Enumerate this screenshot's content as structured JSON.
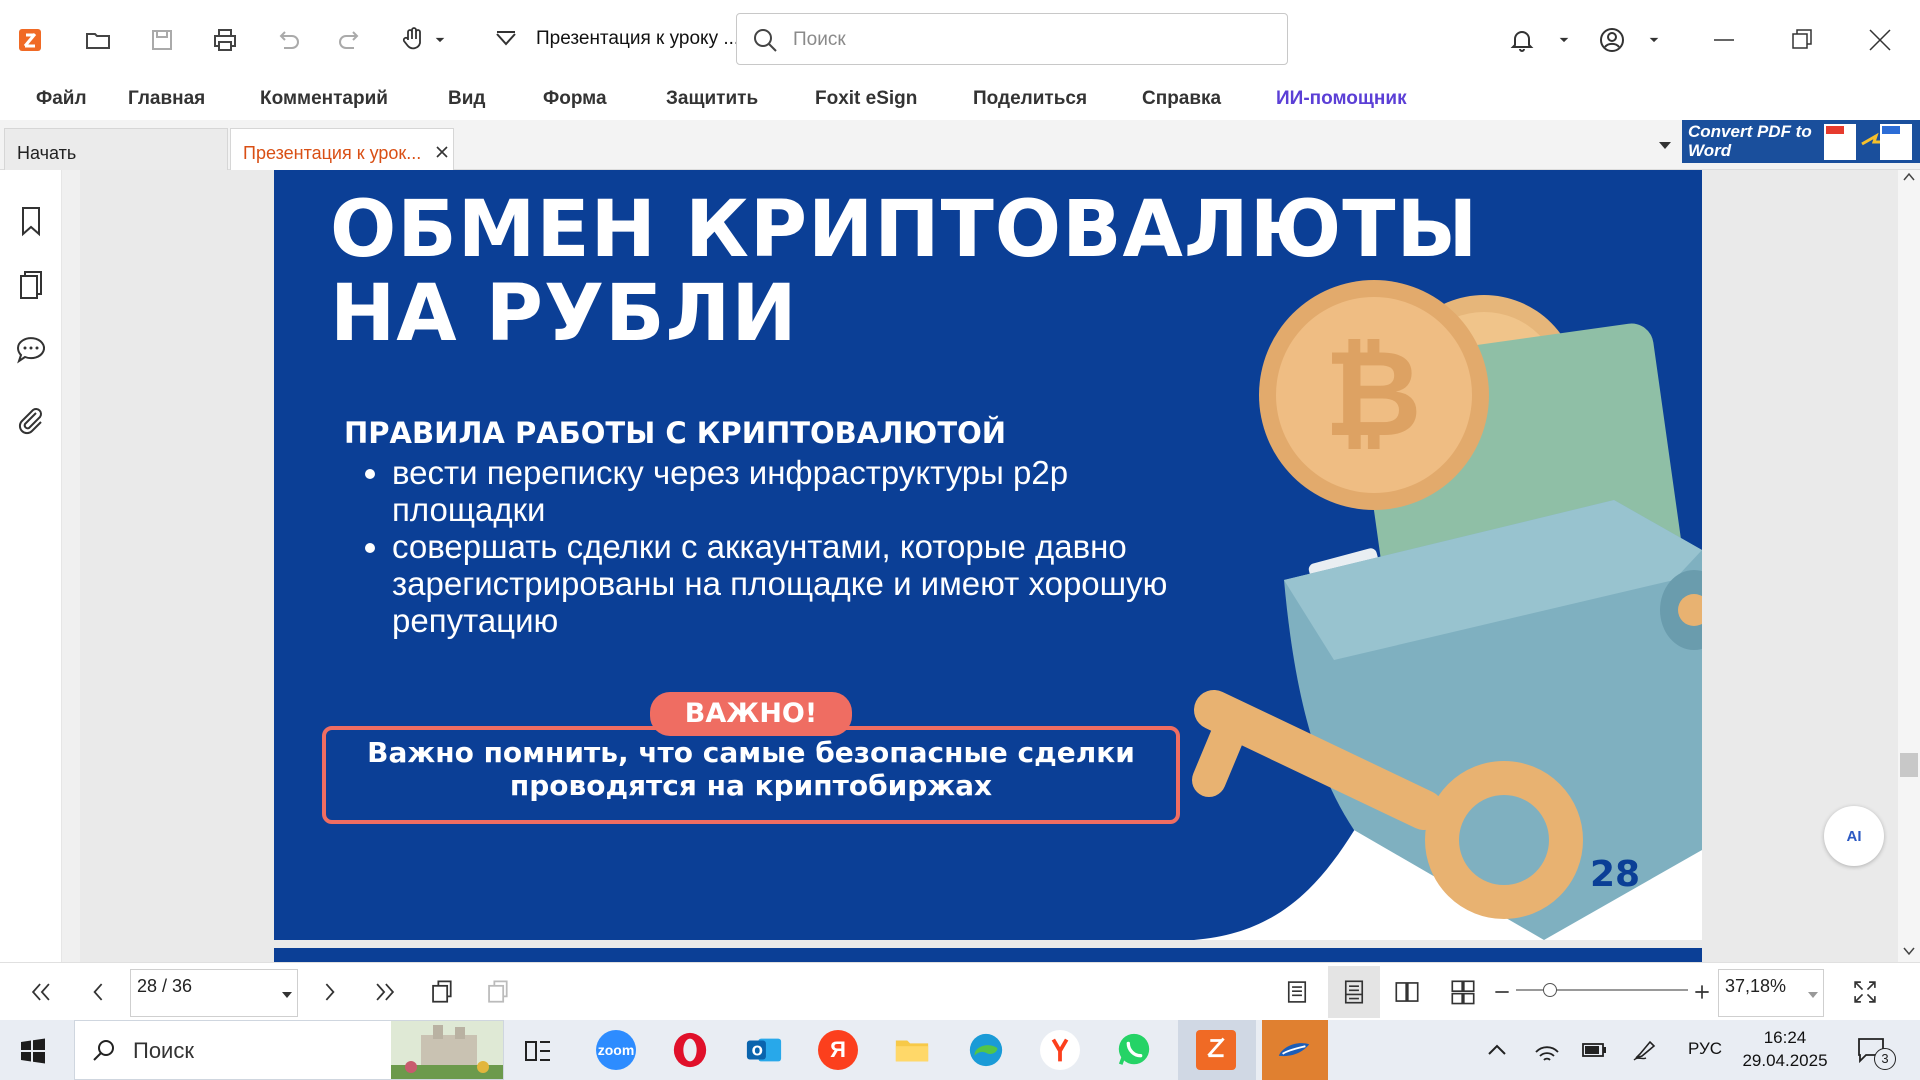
{
  "app": {
    "document_title": "Презентация к уроку ...",
    "search_placeholder": "Поиск"
  },
  "menu": [
    "Файл",
    "Главная",
    "Комментарий",
    "Вид",
    "Форма",
    "Защитить",
    "Foxit eSign",
    "Поделиться",
    "Справка",
    "ИИ-помощник"
  ],
  "tabs": [
    {
      "label": "Начать"
    },
    {
      "label": "Презентация к урок..."
    }
  ],
  "banner": {
    "text": "Convert PDF to Word"
  },
  "slide": {
    "title": "ОБМЕН КРИПТОВАЛЮТЫ\nНА РУБЛИ",
    "rules_heading": "ПРАВИЛА РАБОТЫ С КРИПТОВАЛЮТОЙ",
    "rules": [
      "вести переписку через инфраструктуры p2p площадки",
      "совершать сделки с аккаунтами, которые давно зарегистрированы на площадке и имеют хорошую репутацию"
    ],
    "important_badge": "ВАЖНО!",
    "important_text": "Важно помнить, что самые безопасные сделки проводятся на криптобиржах",
    "page_number": "28"
  },
  "ai_button": "AI",
  "navigation": {
    "page_indicator": "28 / 36",
    "zoom": "37,18%",
    "zoom_slider_fraction": 0.2
  },
  "taskbar": {
    "search_label": "Поиск",
    "language": "РУС",
    "time": "16:24",
    "date": "29.04.2025",
    "notification_count": "3",
    "apps": [
      "task-view",
      "zoom",
      "opera",
      "outlook",
      "yandex",
      "file-explorer",
      "edge",
      "yandex-browser",
      "whatsapp",
      "foxit-reader",
      "cloud-app"
    ]
  },
  "colors": {
    "accent": "#d94f14",
    "slide_bg": "#0b3f96",
    "highlight": "#ef6d62",
    "ai_menu": "#5b3fd6"
  }
}
